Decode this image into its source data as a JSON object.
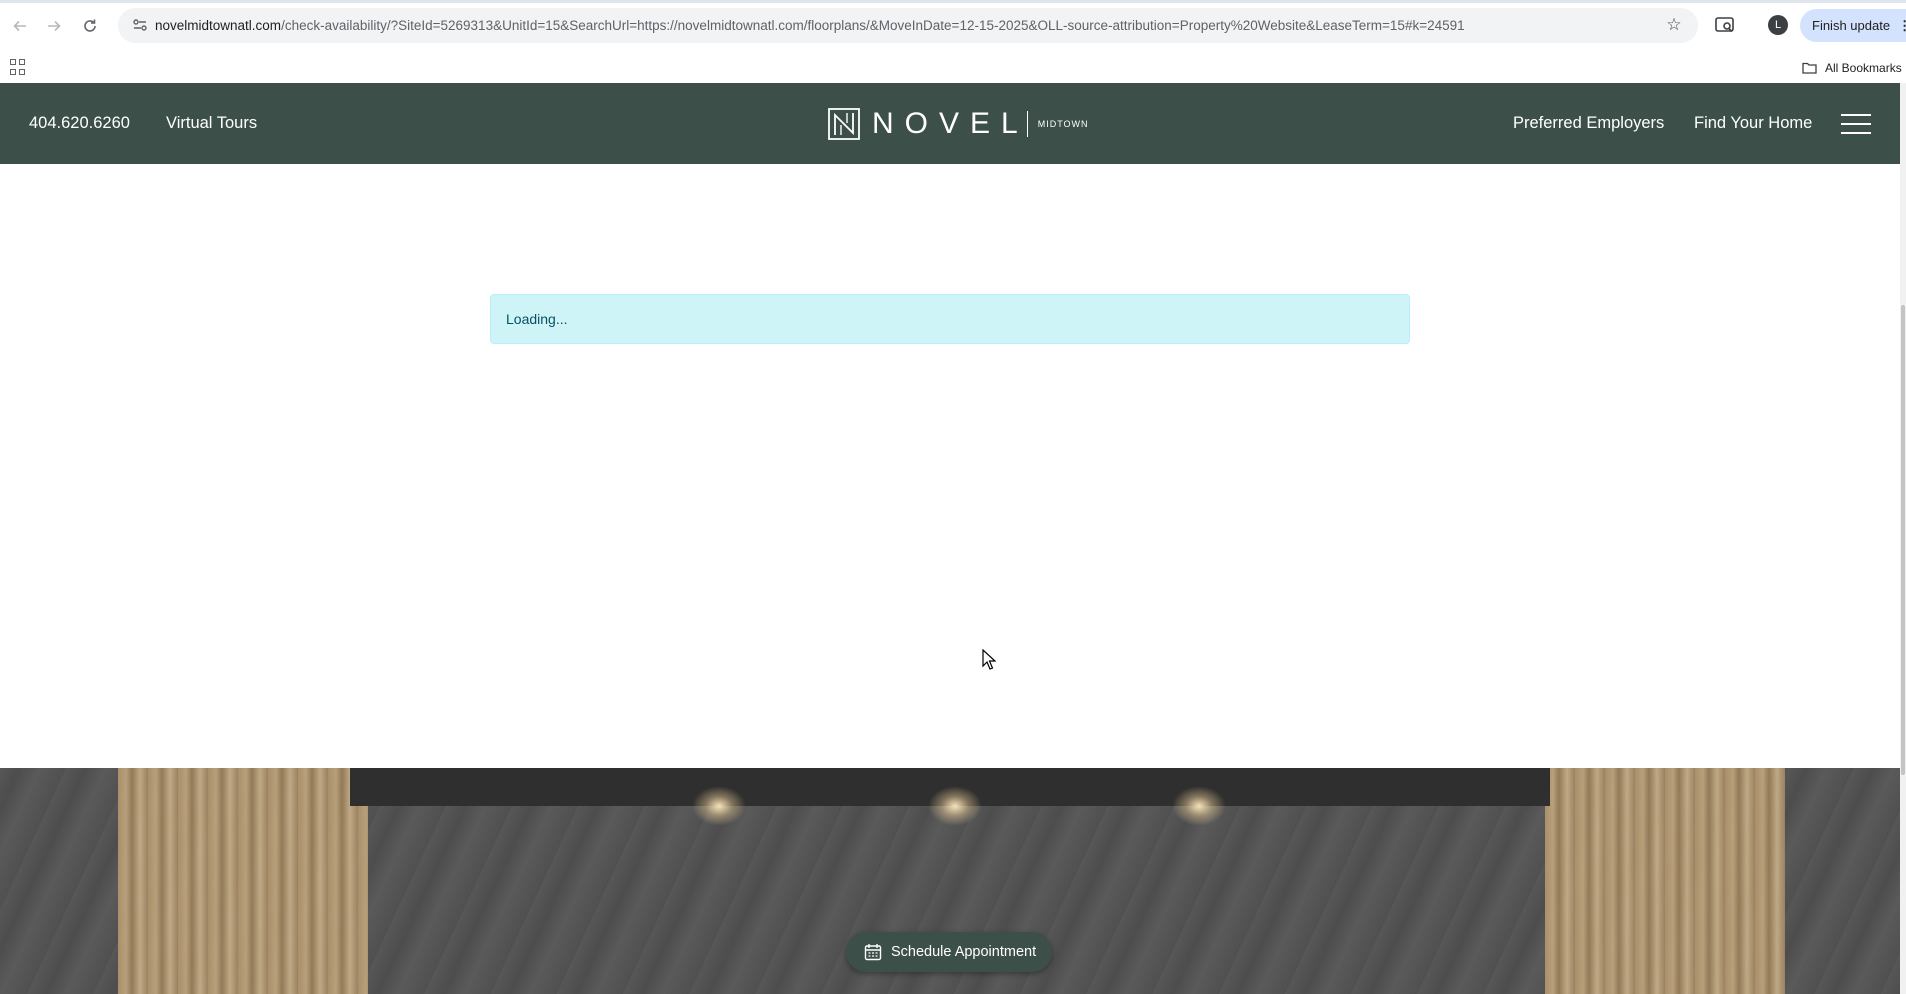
{
  "browser": {
    "url_domain": "novelmidtownatl.com",
    "url_path": "/check-availability/?SiteId=5269313&UnitId=15&SearchUrl=https://novelmidtownatl.com/floorplans/&MoveInDate=12-15-2025&OLL-source-attribution=Property%20Website&LeaseTerm=15#k=24591",
    "profile_initial": "L",
    "finish_update_label": "Finish update",
    "all_bookmarks_label": "All Bookmarks"
  },
  "header": {
    "phone": "404.620.6260",
    "virtual_tours": "Virtual Tours",
    "logo_word": "NOVEL",
    "logo_sub": "MIDTOWN",
    "preferred_employers": "Preferred Employers",
    "find_your_home": "Find Your Home"
  },
  "main": {
    "loading_text": "Loading..."
  },
  "footer": {
    "schedule_label": "Schedule Appointment"
  },
  "colors": {
    "brand_green": "#3c5049",
    "alert_bg": "#cff4f8",
    "alert_text": "#055160"
  }
}
